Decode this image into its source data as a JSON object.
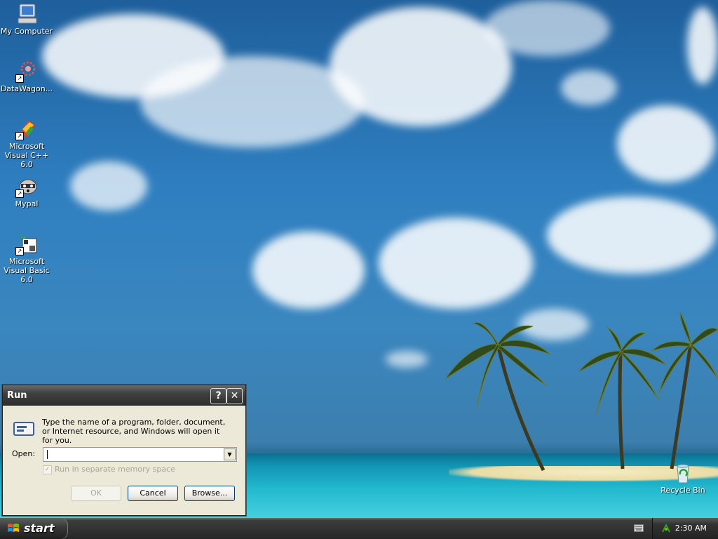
{
  "desktop": {
    "icons": [
      {
        "label": "My Computer"
      },
      {
        "label": "DataWagon..."
      },
      {
        "label": "Microsoft Visual C++ 6.0"
      },
      {
        "label": "Mypal"
      },
      {
        "label": "Microsoft Visual Basic 6.0"
      },
      {
        "label": "Recycle Bin"
      }
    ]
  },
  "run_dialog": {
    "title": "Run",
    "help_label": "?",
    "close_label": "✕",
    "description": "Type the name of a program, folder, document, or Internet resource, and Windows will open it for you.",
    "open_label": "Open:",
    "open_value": "",
    "checkbox_label": "Run in separate memory space",
    "checkbox_checked": true,
    "ok_label": "OK",
    "cancel_label": "Cancel",
    "browse_label": "Browse..."
  },
  "taskbar": {
    "start_label": "start",
    "clock": "2:30 AM"
  },
  "colors": {
    "dialog_bg": "#ece9d8",
    "titlebar": "#3f3f3f",
    "taskbar": "#272727"
  }
}
